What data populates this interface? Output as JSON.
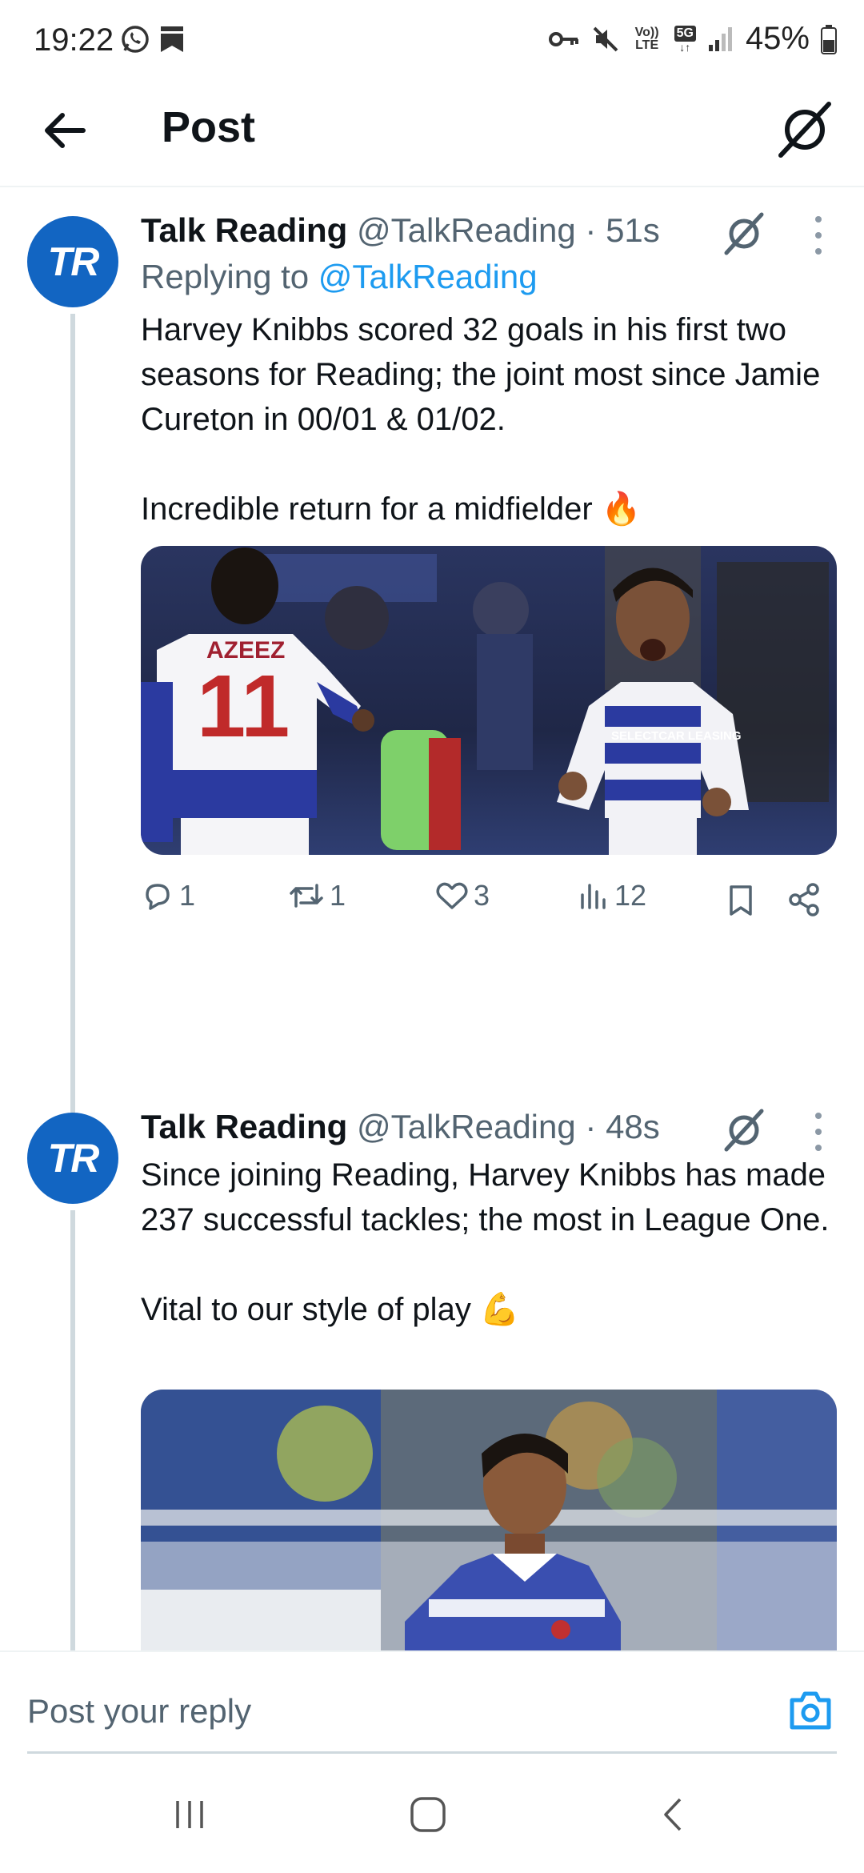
{
  "status_bar": {
    "time": "19:22",
    "lte_label": "Vo)) LTE",
    "network": "5G",
    "battery": "45%"
  },
  "header": {
    "title": "Post"
  },
  "tweets": [
    {
      "avatar_text": "TR",
      "name": "Talk Reading",
      "handle": "@TalkReading",
      "separator": "·",
      "time": "51s",
      "replying_prefix": "Replying to",
      "replying_to": "@TalkReading",
      "paragraphs": [
        "Harvey Knibbs scored 32 goals in his first two seasons for Reading; the joint most since Jamie Cureton in 00/01 & 01/02.",
        "Incredible return for a midfielder 🔥"
      ],
      "image": {
        "jersey_name": "AZEEZ",
        "jersey_number": "11",
        "sponsor": "SELECTCAR LEASING"
      },
      "stats": {
        "replies": "1",
        "reposts": "1",
        "likes": "3",
        "views": "12"
      }
    },
    {
      "avatar_text": "TR",
      "name": "Talk Reading",
      "handle": "@TalkReading",
      "separator": "·",
      "time": "48s",
      "paragraphs": [
        "Since joining Reading, Harvey Knibbs has made 237 successful tackles; the most in League One.",
        "Vital to our style of play 💪"
      ]
    }
  ],
  "reply_bar": {
    "placeholder": "Post your reply"
  },
  "colors": {
    "link": "#1d9bf0",
    "avatar": "#1265c2",
    "secondary_text": "#536471"
  }
}
